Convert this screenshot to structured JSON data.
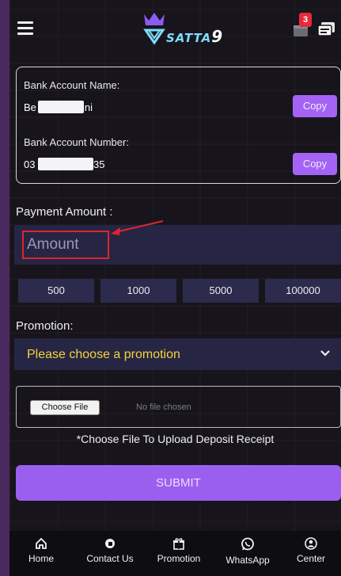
{
  "header": {
    "brand": "SATTA",
    "brand_suffix": "9",
    "notification_count": "3"
  },
  "bank": {
    "name_label": "Bank Account Name:",
    "name_value_start": "Be",
    "name_value_end": "ini",
    "number_label": "Bank Account Number:",
    "number_value_start": "03",
    "number_value_end": "35",
    "copy_label": "Copy"
  },
  "payment": {
    "label": "Payment Amount :",
    "placeholder": "Amount",
    "presets": [
      "500",
      "1000",
      "5000",
      "100000"
    ]
  },
  "promotion": {
    "label": "Promotion:",
    "selected": "Please choose a promotion"
  },
  "upload": {
    "button_label": "Choose File",
    "status": "No file chosen",
    "hint": "*Choose File To Upload Deposit Receipt"
  },
  "submit_label": "SUBMIT",
  "nav": {
    "items": [
      {
        "label": "Home",
        "icon": "home-icon"
      },
      {
        "label": "Contact Us",
        "icon": "headset-icon"
      },
      {
        "label": "Promotion",
        "icon": "gift-icon"
      },
      {
        "label": "WhatsApp",
        "icon": "whatsapp-icon"
      },
      {
        "label": "Center",
        "icon": "user-icon"
      }
    ]
  },
  "colors": {
    "accent": "#a463f5",
    "promo_text": "#f4d33b",
    "highlight": "#e0242f"
  }
}
